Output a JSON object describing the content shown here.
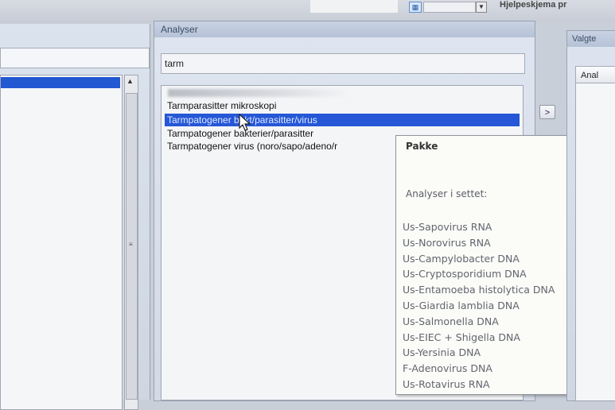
{
  "topbar": {
    "small_field": "",
    "top_text": "Hjelpeskjema pr"
  },
  "analyser": {
    "header": "Analyser",
    "search_value": "tarm",
    "list_items": [
      {
        "label": "Tarmparasitter mikroskopi"
      },
      {
        "label": "Tarmpatogener bakt/parasitter/virus"
      },
      {
        "label": "Tarmpatogener bakterier/parasitter"
      },
      {
        "label": "Tarmpatogener virus (noro/sapo/adeno/r"
      }
    ]
  },
  "tooltip": {
    "title": "Pakke",
    "subtitle": "Analyser i settet:",
    "items": [
      "Us-Sapovirus RNA",
      "Us-Norovirus RNA",
      "Us-Campylobacter DNA",
      "Us-Cryptosporidium DNA",
      "Us-Entamoeba histolytica DNA",
      "Us-Giardia lamblia DNA",
      "Us-Salmonella DNA",
      "Us-EIEC + Shigella DNA",
      "Us-Yersinia DNA",
      "F-Adenovirus DNA",
      "Us-Rotavirus RNA"
    ]
  },
  "move_button": {
    "label": ">"
  },
  "valgte": {
    "header": "Valgte",
    "column": "Anal"
  }
}
